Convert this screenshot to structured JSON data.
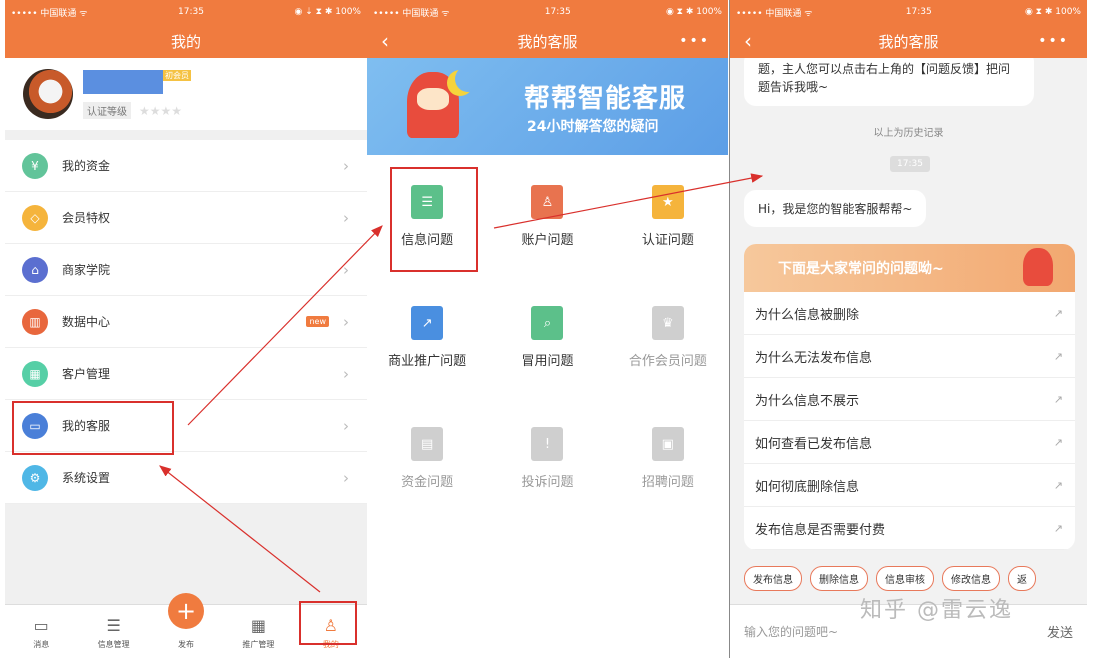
{
  "status": {
    "carrier": "••••• 中国联通 ᯤ",
    "time": "17:35",
    "right1": "◉ ⇣ ⧗ ✱ 100%",
    "right2": "◉ ⧗ ✱ 100%"
  },
  "panel1": {
    "title": "我的",
    "vip": "初会员",
    "cert": "认证等级",
    "stars": "★★★★",
    "menu": [
      {
        "label": "我的资金",
        "icon": "yen-icon",
        "glyph": "¥",
        "color": "#62c49a"
      },
      {
        "label": "会员特权",
        "icon": "diamond-icon",
        "glyph": "◇",
        "color": "#f5b43c"
      },
      {
        "label": "商家学院",
        "icon": "graduation-icon",
        "glyph": "⌂",
        "color": "#5b6fd0"
      },
      {
        "label": "数据中心",
        "icon": "chart-icon",
        "glyph": "▥",
        "color": "#e8673d",
        "badge": "new"
      },
      {
        "label": "客户管理",
        "icon": "grid-icon",
        "glyph": "▦",
        "color": "#56cfa6"
      },
      {
        "label": "我的客服",
        "icon": "chat-icon",
        "glyph": "▭",
        "color": "#4a7fd8"
      },
      {
        "label": "系统设置",
        "icon": "gear-icon",
        "glyph": "⚙",
        "color": "#4fb7e6"
      }
    ],
    "tabs": [
      {
        "label": "消息",
        "glyph": "▭",
        "icon": "message-icon"
      },
      {
        "label": "信息管理",
        "glyph": "☰",
        "icon": "list-icon"
      },
      {
        "label": "发布",
        "glyph": "+",
        "icon": "plus-icon"
      },
      {
        "label": "推广管理",
        "glyph": "▦",
        "icon": "promote-icon"
      },
      {
        "label": "我的",
        "glyph": "♙",
        "icon": "person-icon"
      }
    ]
  },
  "panel2": {
    "title": "我的客服",
    "back": "‹",
    "more": "•••",
    "banner_title": "帮帮智能客服",
    "banner_sub": "24小时解答您的疑问",
    "items": [
      {
        "label": "信息问题",
        "color": "#5cc08a",
        "glyph": "☰",
        "icon": "document-icon"
      },
      {
        "label": "账户问题",
        "color": "#e8734f",
        "glyph": "♙",
        "icon": "account-icon"
      },
      {
        "label": "认证问题",
        "color": "#f5b43c",
        "glyph": "★",
        "icon": "certificate-icon"
      },
      {
        "label": "商业推广问题",
        "color": "#4a8fe0",
        "glyph": "↗",
        "icon": "monitor-icon"
      },
      {
        "label": "冒用问题",
        "color": "#5cc08a",
        "glyph": "⌕",
        "icon": "search-doc-icon"
      },
      {
        "label": "合作会员问题",
        "color": "#cfcfcf",
        "glyph": "♛",
        "icon": "crown-icon"
      },
      {
        "label": "资金问题",
        "color": "#cfcfcf",
        "glyph": "▤",
        "icon": "wallet-icon"
      },
      {
        "label": "投诉问题",
        "color": "#cfcfcf",
        "glyph": "!",
        "icon": "complaint-icon"
      },
      {
        "label": "招聘问题",
        "color": "#cfcfcf",
        "glyph": "▣",
        "icon": "briefcase-icon"
      }
    ]
  },
  "panel3": {
    "title": "我的客服",
    "prev_msg": "题，主人您可以点击右上角的【问题反馈】把问题告诉我哦~",
    "history": "以上为历史记录",
    "time": "17:35",
    "greeting": "Hi，我是您的智能客服帮帮~",
    "faq_header": "下面是大家常问的问题呦~",
    "faqs": [
      "为什么信息被删除",
      "为什么无法发布信息",
      "为什么信息不展示",
      "如何查看已发布信息",
      "如何彻底删除信息",
      "发布信息是否需要付费"
    ],
    "chips": [
      "发布信息",
      "删除信息",
      "信息审核",
      "修改信息",
      "返"
    ],
    "input_placeholder": "输入您的问题吧~",
    "send": "发送"
  },
  "watermark": "知乎 @雷云逸"
}
